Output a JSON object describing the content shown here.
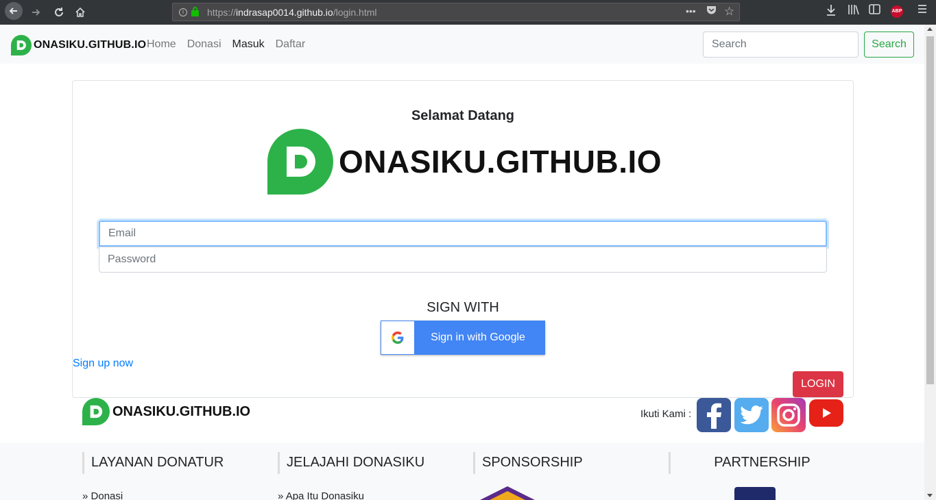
{
  "browser": {
    "url_prefix": "https://",
    "url_host": "indrasap0014.github.io",
    "url_path": "/login.html",
    "page_actions_label": "•••",
    "abp_label": "ABP"
  },
  "navbar": {
    "brand": "ONASIKU.GITHUB.IO",
    "links": [
      {
        "label": "Home"
      },
      {
        "label": "Donasi"
      },
      {
        "label": "Masuk"
      },
      {
        "label": "Daftar"
      }
    ],
    "search_placeholder": "Search",
    "search_button": "Search"
  },
  "login": {
    "welcome": "Selamat Datang",
    "logo_text": "ONASIKU.GITHUB.IO",
    "email_placeholder": "Email",
    "password_placeholder": "Password",
    "sign_with": "SIGN WITH",
    "google_button": "Sign in with Google",
    "signup_link": "Sign up now",
    "login_button": "LOGIN"
  },
  "follow": {
    "brand": "ONASIKU.GITHUB.IO",
    "label": "Ikuti Kami :",
    "networks": [
      "facebook",
      "twitter",
      "instagram",
      "youtube"
    ]
  },
  "footer": {
    "columns": [
      {
        "title": "LAYANAN DONATUR",
        "first_link": "Donasi"
      },
      {
        "title": "JELAJAHI DONASIKU",
        "first_link": "Apa Itu Donasiku"
      },
      {
        "title": "SPONSORSHIP"
      },
      {
        "title": "PARTNERSHIP"
      }
    ]
  },
  "colors": {
    "brand_green": "#2db24a",
    "search_green": "#28a745",
    "login_red": "#dc3545",
    "google_blue": "#4285f4",
    "link_blue": "#007bff"
  }
}
